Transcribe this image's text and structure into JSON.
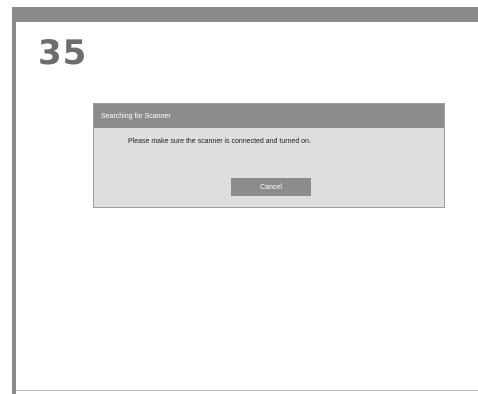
{
  "page": {
    "number": "35"
  },
  "dialog": {
    "title": "Searching for Scanner",
    "message": "Please make sure the scanner is connected and turned on.",
    "cancel_label": "Cancel"
  },
  "colors": {
    "frame": "#8a8a8a",
    "dialog_header": "#8c8c8c",
    "dialog_body": "#dedede",
    "button": "#8c8c8c",
    "page_number": "#6d6d6d"
  }
}
